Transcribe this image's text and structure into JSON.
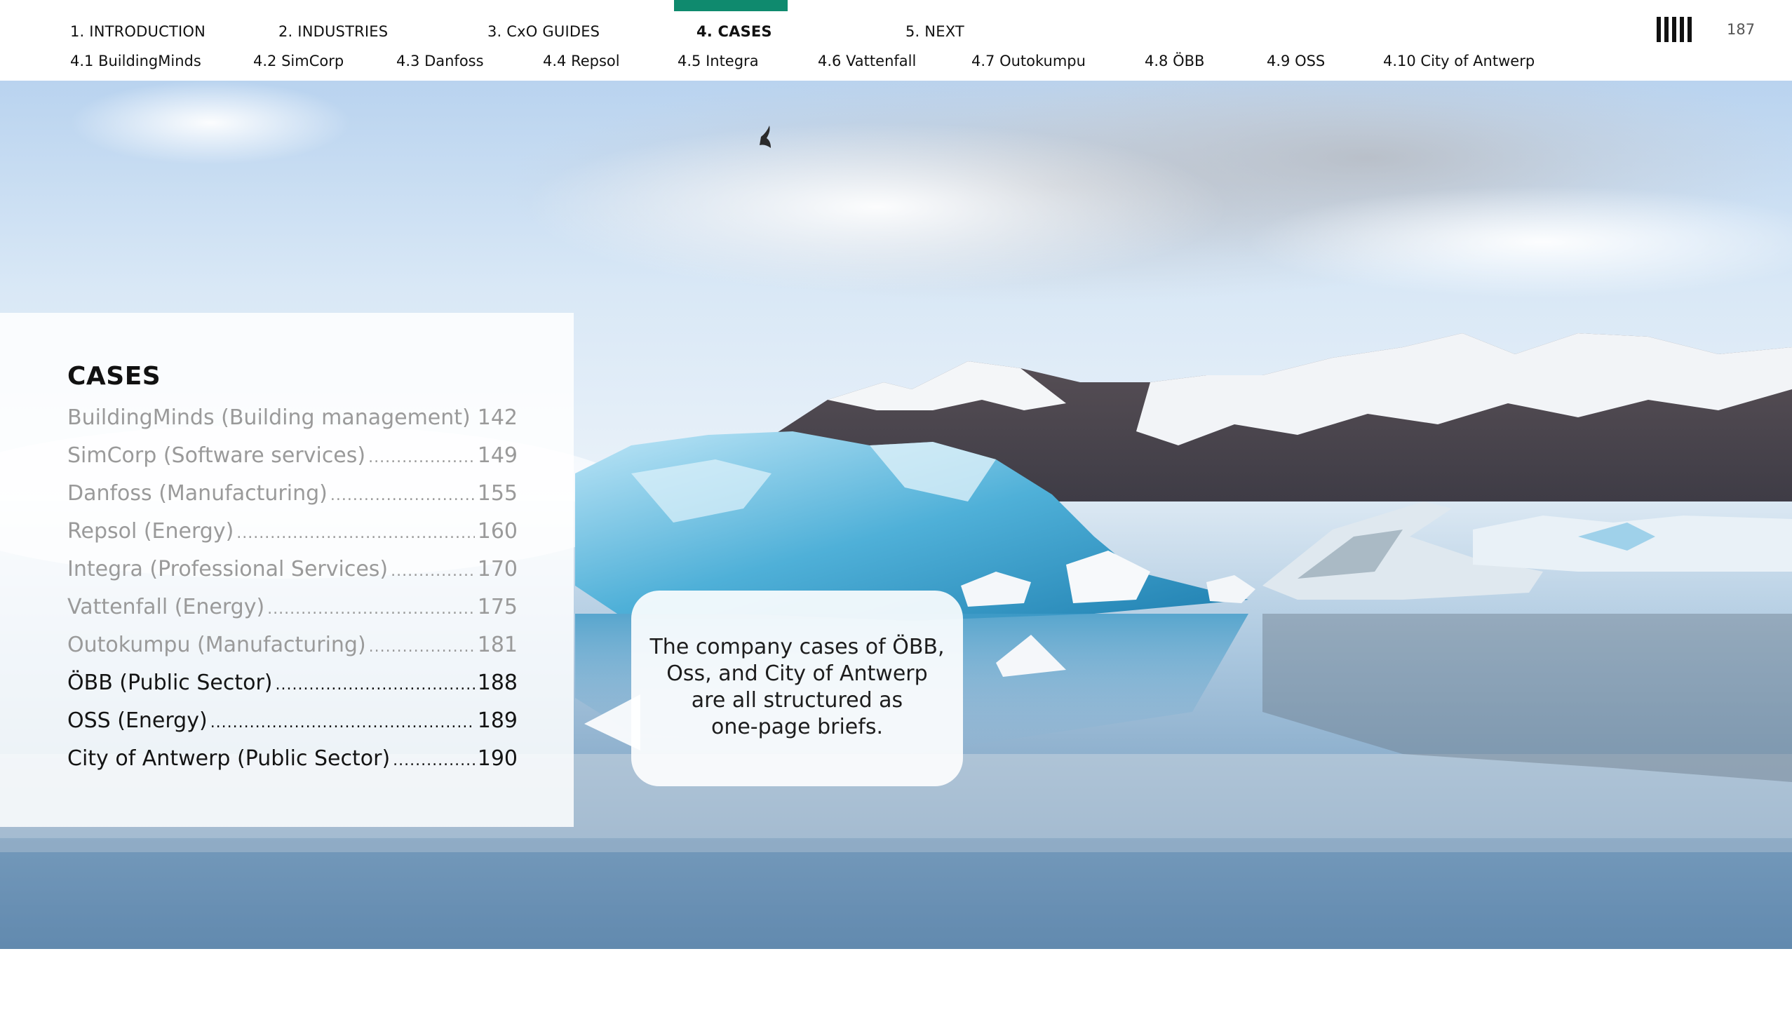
{
  "nav": {
    "main_tabs": [
      {
        "label": "1. INTRODUCTION"
      },
      {
        "label": "2. INDUSTRIES"
      },
      {
        "label": "3. CxO GUIDES"
      },
      {
        "label": "4. CASES"
      },
      {
        "label": "5. NEXT"
      }
    ],
    "active_index": 3,
    "sub_tabs": [
      {
        "label": "4.1 BuildingMinds"
      },
      {
        "label": "4.2 SimCorp"
      },
      {
        "label": "4.3 Danfoss"
      },
      {
        "label": "4.4 Repsol"
      },
      {
        "label": "4.5 Integra"
      },
      {
        "label": "4.6 Vattenfall"
      },
      {
        "label": "4.7 Outokumpu"
      },
      {
        "label": "4.8 ÖBB"
      },
      {
        "label": "4.9 OSS"
      },
      {
        "label": "4.10 City of Antwerp"
      }
    ],
    "menu_icon": "barcode-menu-icon",
    "page_number": "187"
  },
  "colors": {
    "accent": "#0f8a6e"
  },
  "hero": {
    "image": "glacier-lagoon-photo"
  },
  "toc": {
    "title": "CASES",
    "items": [
      {
        "label": "BuildingMinds (Building management)",
        "page": "142",
        "emphasis": "dim"
      },
      {
        "label": "SimCorp (Software services)",
        "page": "149",
        "emphasis": "dim"
      },
      {
        "label": "Danfoss (Manufacturing)",
        "page": "155",
        "emphasis": "dim"
      },
      {
        "label": "Repsol (Energy)",
        "page": "160",
        "emphasis": "dim"
      },
      {
        "label": "Integra (Professional Services)",
        "page": "170",
        "emphasis": "dim"
      },
      {
        "label": "Vattenfall (Energy)",
        "page": "175",
        "emphasis": "dim"
      },
      {
        "label": "Outokumpu (Manufacturing)",
        "page": " 181",
        "emphasis": "dim"
      },
      {
        "label": "ÖBB (Public Sector)",
        "page": "188",
        "emphasis": "dark"
      },
      {
        "label": "OSS (Energy)",
        "page": "189",
        "emphasis": "dark"
      },
      {
        "label": "City of Antwerp (Public Sector)",
        "page": "190",
        "emphasis": "dark"
      }
    ]
  },
  "callout": {
    "lines": [
      "The company cases of ÖBB,",
      "Oss, and City of Antwerp",
      "are all structured as",
      "one-page briefs."
    ]
  }
}
